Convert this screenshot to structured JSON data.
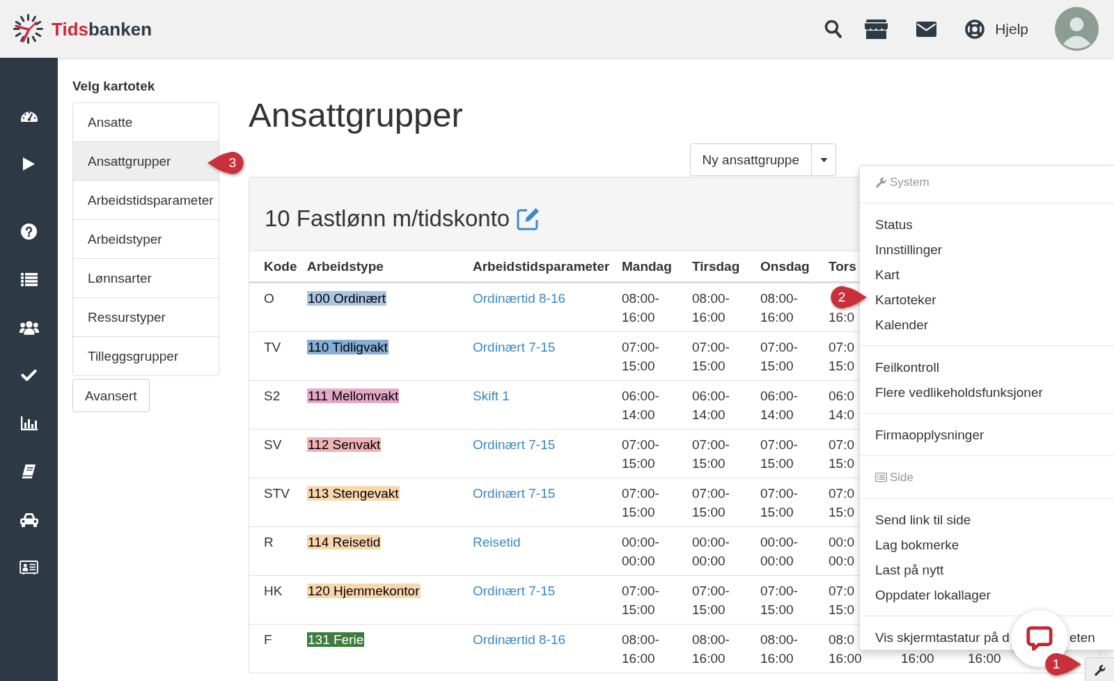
{
  "top_bar": {
    "logo": {
      "accent": "Tids",
      "rest": "banken"
    },
    "help_link": "Hjelp"
  },
  "catalog": {
    "heading": "Velg kartotek",
    "items": [
      {
        "label": "Ansatte",
        "selected": false
      },
      {
        "label": "Ansattgrupper",
        "selected": true,
        "callout": "3"
      },
      {
        "label": "Arbeidstidsparameter",
        "selected": false
      },
      {
        "label": "Arbeidstyper",
        "selected": false
      },
      {
        "label": "Lønnsarter",
        "selected": false
      },
      {
        "label": "Ressurstyper",
        "selected": false
      },
      {
        "label": "Tilleggsgrupper",
        "selected": false
      }
    ],
    "advanced_button": "Avansert"
  },
  "main": {
    "title": "Ansattgrupper",
    "new_button": "Ny ansattgruppe",
    "panel": {
      "title": "10 Fastlønn m/tidskonto",
      "columns": [
        "Kode",
        "Arbeidstype",
        "Arbeidstidsparameter",
        "Mandag",
        "Tirsdag",
        "Onsdag",
        "Tors"
      ],
      "rows": [
        {
          "code": "O",
          "work_type": "100 Ordinært",
          "color": "#a9c5e1",
          "parameter": "Ordinærtid 8-16",
          "times": [
            [
              "08:00-",
              "16:00"
            ],
            [
              "08:00-",
              "16:00"
            ],
            [
              "08:00-",
              "16:00"
            ],
            [
              "16:0"
            ]
          ]
        },
        {
          "code": "TV",
          "work_type": "110 Tidligvakt",
          "color": "#86aed7",
          "parameter": "Ordinært 7-15",
          "times": [
            [
              "07:00-",
              "15:00"
            ],
            [
              "07:00-",
              "15:00"
            ],
            [
              "07:00-",
              "15:00"
            ],
            [
              "07:0",
              "15:0"
            ]
          ]
        },
        {
          "code": "S2",
          "work_type": "111 Mellomvakt",
          "color": "#e6a9c9",
          "parameter": "Skift 1",
          "times": [
            [
              "06:00-",
              "14:00"
            ],
            [
              "06:00-",
              "14:00"
            ],
            [
              "06:00-",
              "14:00"
            ],
            [
              "06:0",
              "14:0"
            ]
          ]
        },
        {
          "code": "SV",
          "work_type": "112 Senvakt",
          "color": "#efb3b5",
          "parameter": "Ordinært 7-15",
          "times": [
            [
              "07:00-",
              "15:00"
            ],
            [
              "07:00-",
              "15:00"
            ],
            [
              "07:00-",
              "15:00"
            ],
            [
              "07:0",
              "15:0"
            ]
          ]
        },
        {
          "code": "STV",
          "work_type": "113 Stengevakt",
          "color": "#f9d7ae",
          "parameter": "Ordinært 7-15",
          "times": [
            [
              "07:00-",
              "15:00"
            ],
            [
              "07:00-",
              "15:00"
            ],
            [
              "07:00-",
              "15:00"
            ],
            [
              "07:0",
              "15:0"
            ]
          ]
        },
        {
          "code": "R",
          "work_type": "114 Reisetid",
          "color": "#f9d7ae",
          "parameter": "Reisetid",
          "times": [
            [
              "00:00-",
              "00:00"
            ],
            [
              "00:00-",
              "00:00"
            ],
            [
              "00:00-",
              "00:00"
            ],
            [
              "00:0",
              "00:0"
            ]
          ]
        },
        {
          "code": "HK",
          "work_type": "120 Hjemmekontor",
          "color": "#f9d7ae",
          "parameter": "Ordinært 7-15",
          "times": [
            [
              "07:00-",
              "15:00"
            ],
            [
              "07:00-",
              "15:00"
            ],
            [
              "07:00-",
              "15:00"
            ],
            [
              "07:0",
              "15:0"
            ]
          ]
        },
        {
          "code": "F",
          "work_type": "131 Ferie",
          "color": "#3c7c3d",
          "parameter": "Ordinærtid 8-16",
          "times": [
            [
              "08:00-",
              "16:00"
            ],
            [
              "08:00-",
              "16:00"
            ],
            [
              "08:00-",
              "16:00"
            ],
            [
              "08:0",
              "16:00"
            ],
            [
              "16:00"
            ],
            [
              "16:00"
            ]
          ]
        }
      ]
    }
  },
  "menu": {
    "entries": [
      {
        "kind": "header",
        "label": "System"
      },
      {
        "kind": "divider"
      },
      {
        "kind": "item",
        "label": "Status"
      },
      {
        "kind": "item",
        "label": "Innstillinger"
      },
      {
        "kind": "item",
        "label": "Kart"
      },
      {
        "kind": "item",
        "label": "Kartoteker",
        "callout": "2"
      },
      {
        "kind": "item",
        "label": "Kalender"
      },
      {
        "kind": "divider"
      },
      {
        "kind": "item",
        "label": "Feilkontroll"
      },
      {
        "kind": "item",
        "label": "Flere vedlikeholdsfunksjoner"
      },
      {
        "kind": "divider"
      },
      {
        "kind": "item",
        "label": "Firmaopplysninger"
      },
      {
        "kind": "divider"
      },
      {
        "kind": "header",
        "label": "Side"
      },
      {
        "kind": "divider"
      },
      {
        "kind": "item",
        "label": "Send link til side"
      },
      {
        "kind": "item",
        "label": "Lag bokmerke"
      },
      {
        "kind": "item",
        "label": "Last på nytt"
      },
      {
        "kind": "item",
        "label": "Oppdater lokallager"
      },
      {
        "kind": "divider"
      },
      {
        "kind": "item",
        "label": "Vis skjermtastatur på d",
        "label_end": "eten"
      }
    ]
  },
  "tools_button": {
    "callout": "1"
  }
}
